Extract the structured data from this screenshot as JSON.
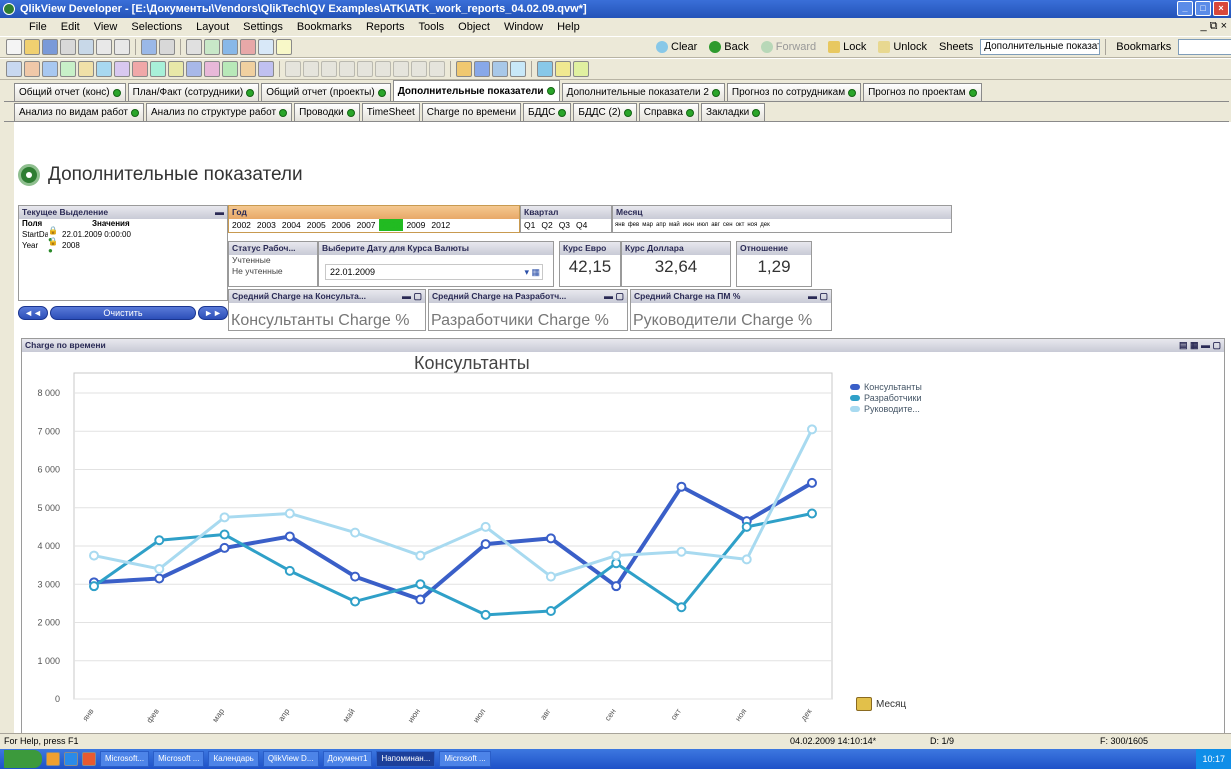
{
  "window": {
    "title": "QlikView Developer - [E:\\Документы\\Vendors\\QlikTech\\QV Examples\\ATK\\ATK_work_reports_04.02.09.qvw*]"
  },
  "menu": [
    "File",
    "Edit",
    "View",
    "Selections",
    "Layout",
    "Settings",
    "Bookmarks",
    "Reports",
    "Tools",
    "Object",
    "Window",
    "Help"
  ],
  "toolbar": {
    "clear_label": "Clear",
    "back_label": "Back",
    "forward_label": "Forward",
    "lock_label": "Lock",
    "unlock_label": "Unlock",
    "sheets_label": "Sheets",
    "sheets_value": "Дополнительные показател",
    "bookmarks_label": "Bookmarks"
  },
  "tabs_row1": [
    {
      "label": "Общий отчет (конс)",
      "active": false
    },
    {
      "label": "План/Факт (сотрудники)",
      "active": false
    },
    {
      "label": "Общий отчет (проекты)",
      "active": false
    },
    {
      "label": "Дополнительные показатели",
      "active": true
    },
    {
      "label": "Дополнительные показатели 2",
      "active": false
    },
    {
      "label": "Прогноз по сотрудникам",
      "active": false
    },
    {
      "label": "Прогноз по проектам",
      "active": false
    }
  ],
  "tabs_row2": [
    {
      "label": "Анализ по видам работ"
    },
    {
      "label": "Анализ по структуре работ"
    },
    {
      "label": "Проводки"
    },
    {
      "label": "TimeSheet"
    },
    {
      "label": "Charge по времени"
    },
    {
      "label": "БДДС"
    },
    {
      "label": "БДДС (2)"
    },
    {
      "label": "Справка"
    },
    {
      "label": "Закладки"
    }
  ],
  "sheet": {
    "title": "Дополнительные показатели"
  },
  "current_selections": {
    "caption": "Текущее Выделение",
    "col_field": "Поля",
    "col_value": "Значения",
    "rows": [
      {
        "field": "StartDate_C",
        "value": "22.01.2009 0:00:00"
      },
      {
        "field": "Year",
        "value": "2008"
      }
    ]
  },
  "year_box": {
    "caption": "Год",
    "years": [
      "2002",
      "2003",
      "2004",
      "2005",
      "2006",
      "2007",
      "2008",
      "2009",
      "2012"
    ],
    "selected": "2008"
  },
  "quarter_box": {
    "caption": "Квартал",
    "items": [
      "Q1",
      "Q2",
      "Q3",
      "Q4"
    ]
  },
  "month_box": {
    "caption": "Месяц",
    "items": [
      "янв",
      "фев",
      "мар",
      "апр",
      "май",
      "июн",
      "июл",
      "авг",
      "сен",
      "окт",
      "ноя",
      "дек"
    ]
  },
  "status_box": {
    "caption": "Статус Рабоч...",
    "items": [
      "Учтенные",
      "Не учтенные"
    ]
  },
  "date_box": {
    "caption": "Выберите Дату для Курса Валюты",
    "value": "22.01.2009"
  },
  "euro_box": {
    "caption": "Курс Евро",
    "value": "42,15"
  },
  "dollar_box": {
    "caption": "Курс Доллара",
    "value": "32,64"
  },
  "ratio_box": {
    "caption": "Отношение",
    "value": "1,29"
  },
  "clear_button": "Очистить",
  "gauges": [
    {
      "caption": "Средний Charge на Консульта...",
      "text": "Консультанты Charge %"
    },
    {
      "caption": "Средний Charge на Разработч...",
      "text": "Разработчики Charge %"
    },
    {
      "caption": "Средний Charge на ПМ %",
      "text": "Руководители Charge %"
    }
  ],
  "chart_box": {
    "caption": "Charge по времени",
    "dimension_label": "Месяц"
  },
  "chart_data": {
    "type": "line",
    "title": "Консультанты",
    "xlabel": "Месяц",
    "ylabel": "",
    "categories": [
      "янв",
      "фев",
      "мар",
      "апр",
      "май",
      "июн",
      "июл",
      "авг",
      "сен",
      "окт",
      "ноя",
      "дек"
    ],
    "ylim": [
      0,
      8000
    ],
    "yticks": [
      0,
      1000,
      2000,
      3000,
      4000,
      5000,
      6000,
      7000,
      8000
    ],
    "ytick_labels": [
      "0",
      "1 000",
      "2 000",
      "3 000",
      "4 000",
      "5 000",
      "6 000",
      "7 000",
      "8 000"
    ],
    "grid": true,
    "legend": "top-right",
    "series": [
      {
        "name": "Консультанты",
        "color": "#3a5fc8",
        "width": 4,
        "values": [
          3050,
          3150,
          3950,
          4250,
          3200,
          2600,
          4050,
          4200,
          2950,
          5550,
          4650,
          5650
        ]
      },
      {
        "name": "Разработчики",
        "color": "#2fa0c8",
        "width": 3,
        "values": [
          2950,
          4150,
          4300,
          3350,
          2550,
          3000,
          2200,
          2300,
          3550,
          2400,
          4500,
          4850
        ]
      },
      {
        "name": "Руководите...",
        "color": "#a8daf0",
        "width": 3,
        "values": [
          3750,
          3400,
          4750,
          4850,
          4350,
          3750,
          4500,
          3200,
          3750,
          3850,
          3650,
          7050
        ]
      }
    ]
  },
  "status_bar": {
    "help": "For Help, press F1",
    "datetime": "04.02.2009 14:10:14*",
    "d": "D: 1/9",
    "f": "F: 300/1605"
  },
  "taskbar": {
    "items": [
      "Microsoft...",
      "Microsoft ...",
      "Календарь",
      "QlikView D...",
      "Документ1",
      "Напоминан...",
      "Microsoft ..."
    ],
    "clock": "10:17"
  }
}
